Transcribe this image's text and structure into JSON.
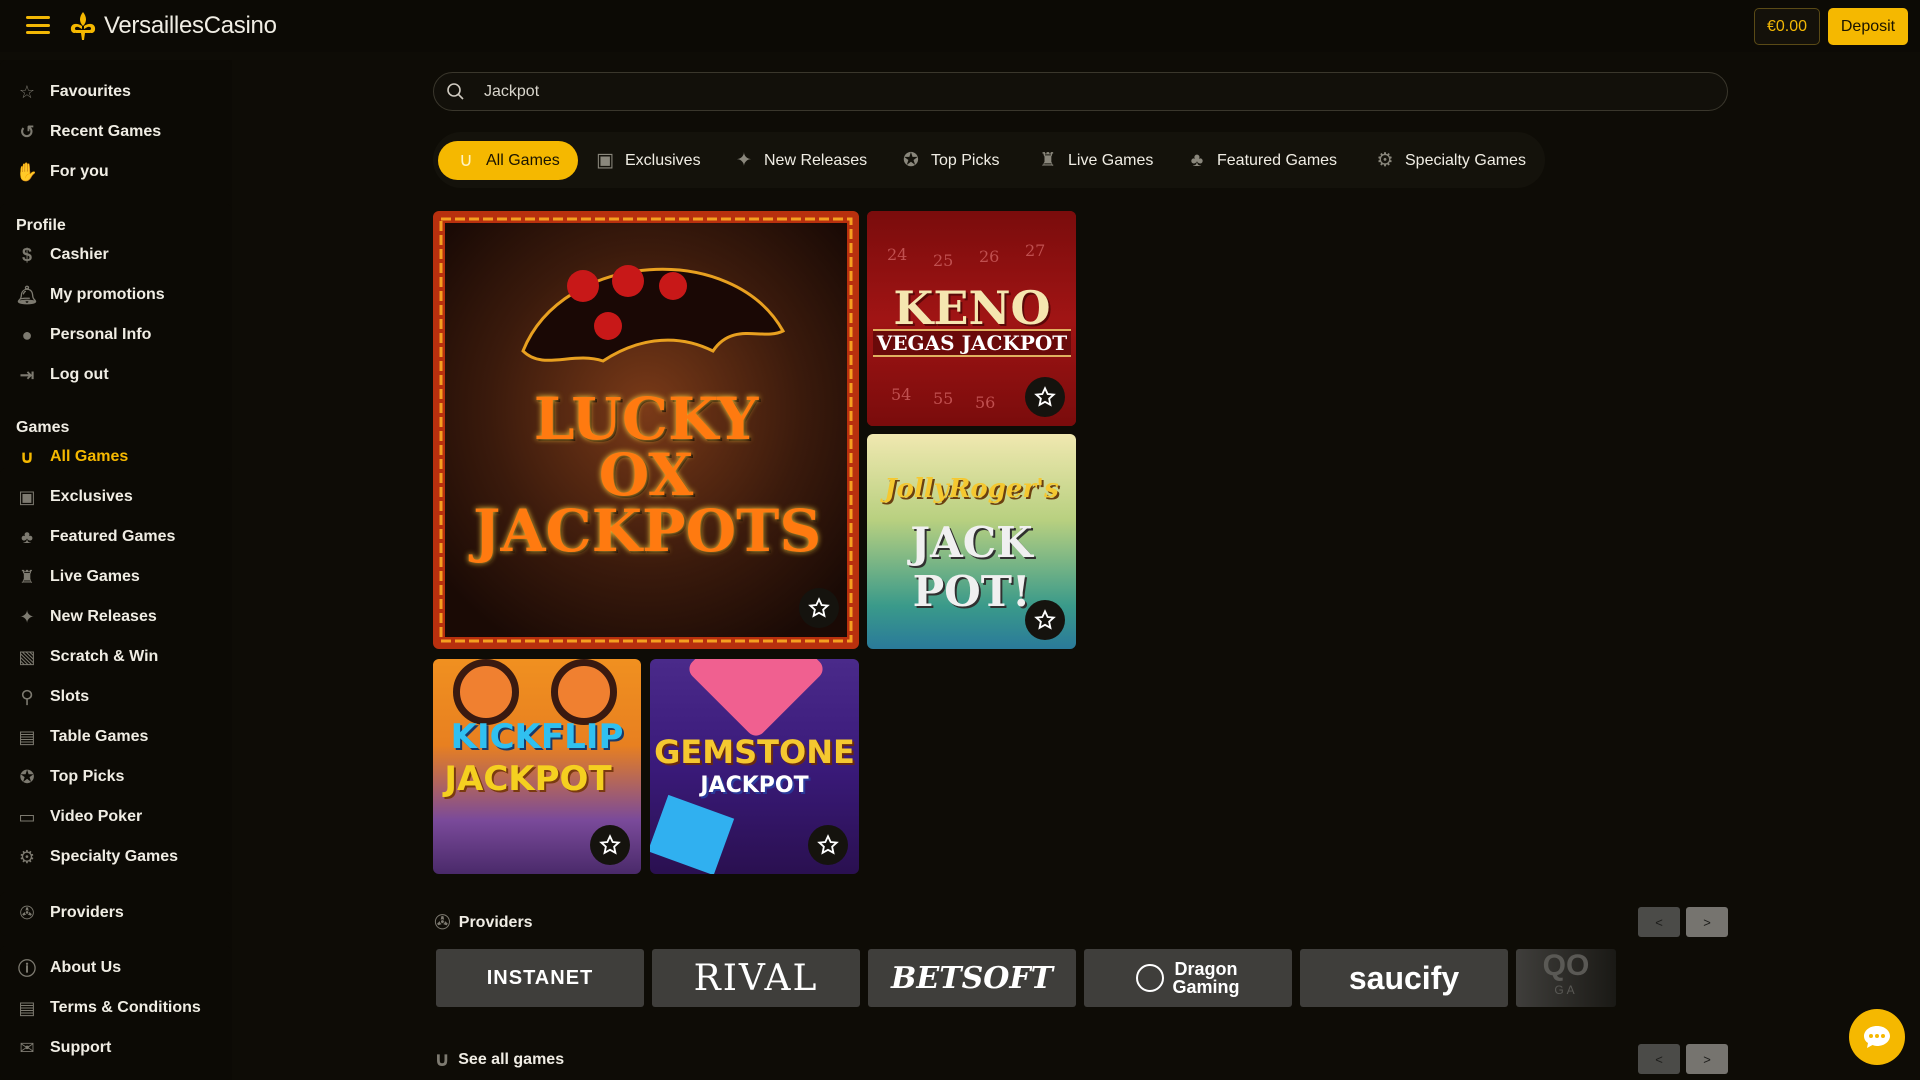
{
  "header": {
    "brand": "VersaillesCasino",
    "balance": "€0.00",
    "deposit_label": "Deposit",
    "colors": {
      "accent": "#f5b800",
      "background": "#0e0c06"
    }
  },
  "sidebar": {
    "quick": [
      {
        "label": "Favourites",
        "icon": "star-icon"
      },
      {
        "label": "Recent Games",
        "icon": "history-icon"
      },
      {
        "label": "For you",
        "icon": "hand-icon"
      }
    ],
    "profile_heading": "Profile",
    "profile": [
      {
        "label": "Cashier",
        "icon": "dollar-icon"
      },
      {
        "label": "My promotions",
        "icon": "bell-icon"
      },
      {
        "label": "Personal Info",
        "icon": "user-icon"
      },
      {
        "label": "Log out",
        "icon": "logout-icon"
      }
    ],
    "games_heading": "Games",
    "games": [
      {
        "label": "All Games",
        "icon": "horseshoe-icon",
        "active": true
      },
      {
        "label": "Exclusives",
        "icon": "exclusive-icon"
      },
      {
        "label": "Featured Games",
        "icon": "clover-icon"
      },
      {
        "label": "Live Games",
        "icon": "live-dealer-icon"
      },
      {
        "label": "New Releases",
        "icon": "new-icon"
      },
      {
        "label": "Scratch & Win",
        "icon": "scratch-icon"
      },
      {
        "label": "Slots",
        "icon": "slot-lever-icon"
      },
      {
        "label": "Table Games",
        "icon": "cards-icon"
      },
      {
        "label": "Top Picks",
        "icon": "award-icon"
      },
      {
        "label": "Video Poker",
        "icon": "video-poker-icon"
      },
      {
        "label": "Specialty Games",
        "icon": "gear-icon"
      }
    ],
    "providers": [
      {
        "label": "Providers",
        "icon": "chip-icon"
      }
    ],
    "info": [
      {
        "label": "About Us",
        "icon": "info-icon"
      },
      {
        "label": "Terms & Conditions",
        "icon": "document-icon"
      },
      {
        "label": "Support",
        "icon": "mail-icon"
      }
    ]
  },
  "search": {
    "value": "Jackpot"
  },
  "tabs": [
    {
      "label": "All Games",
      "icon": "horseshoe-icon",
      "active": true
    },
    {
      "label": "Exclusives",
      "icon": "exclusive-icon"
    },
    {
      "label": "New Releases",
      "icon": "new-icon"
    },
    {
      "label": "Top Picks",
      "icon": "award-icon"
    },
    {
      "label": "Live Games",
      "icon": "live-dealer-icon"
    },
    {
      "label": "Featured Games",
      "icon": "clover-icon"
    },
    {
      "label": "Specialty Games",
      "icon": "gear-icon"
    }
  ],
  "games": {
    "lucky": {
      "line1": "LUCKY",
      "line2": "OX",
      "line3": "JACKPOTS"
    },
    "keno": {
      "title": "KENO",
      "subtitle": "VEGAS JACKPOT",
      "numbers": [
        "24",
        "25",
        "26",
        "27",
        "54",
        "55",
        "56"
      ]
    },
    "jolly": {
      "line1": "JollyRoger's",
      "line2": "JACK POT!"
    },
    "kickflip": {
      "line1": "KICKFLIP",
      "line2": "JACKPOT"
    },
    "gemstone": {
      "line1": "GEMSTONE",
      "line2": "JACKPOT"
    }
  },
  "providers_section": {
    "title": "Providers",
    "prev": "<",
    "next": ">",
    "logos": [
      {
        "name": "INSTANET"
      },
      {
        "name": "RIVAL"
      },
      {
        "name": "BETSOFT"
      },
      {
        "name": "Dragon",
        "sub": "Gaming"
      },
      {
        "name": "saucify"
      },
      {
        "name": "QO",
        "sub": "GA"
      }
    ]
  },
  "see_all": {
    "title": "See all games",
    "prev": "<",
    "next": ">"
  }
}
